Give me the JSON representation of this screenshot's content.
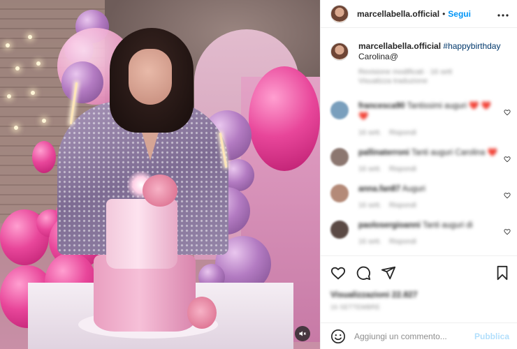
{
  "post": {
    "username": "marcellabella.official",
    "separator": "•",
    "follow_label": "Segui",
    "more_label": "•••",
    "caption_hashtag": "#happybirthday",
    "caption_text": "Carolina@",
    "caption_meta_line1": "Revisione modificati · 16 sett",
    "caption_meta_line2": "Visualizza traduzione"
  },
  "comments": [
    {
      "user": "francesca90",
      "text": "Tantissimi auguri ❤️ ❤️ ❤️",
      "time": "16 sett.",
      "reply": "Rispondi",
      "avatar_color": "#7a9fbd"
    },
    {
      "user": "pallinaterroni",
      "text": "Tanti auguri Carolina ❤️",
      "time": "16 sett.",
      "reply": "Rispondi",
      "avatar_color": "#8c7770"
    },
    {
      "user": "anna.fan87",
      "text": "Auguri",
      "time": "16 sett.",
      "reply": "Rispondi",
      "avatar_color": "#b48a78"
    },
    {
      "user": "paolosergioanni",
      "text": "Tanti auguri di",
      "time": "16 sett.",
      "reply": "Rispondi",
      "avatar_color": "#5b4a45"
    }
  ],
  "actions": {
    "likes_label": "Visualizzazioni 22.827",
    "date_label": "16 SETTEMBRE"
  },
  "add_comment": {
    "placeholder": "Aggiungi un commento...",
    "post_label": "Pubblica"
  },
  "icons": {
    "mute": "speaker-muted-icon",
    "like": "heart-icon",
    "comment": "speech-bubble-icon",
    "share": "paper-plane-icon",
    "save": "bookmark-icon",
    "emoji": "smiley-icon",
    "comment_like": "small-heart-icon",
    "more": "more-dots-icon"
  },
  "colors": {
    "accent": "#0095f6",
    "hashtag": "#00376b",
    "secondary_text": "#8e8e8e",
    "disabled_post": "#b2dffc"
  }
}
